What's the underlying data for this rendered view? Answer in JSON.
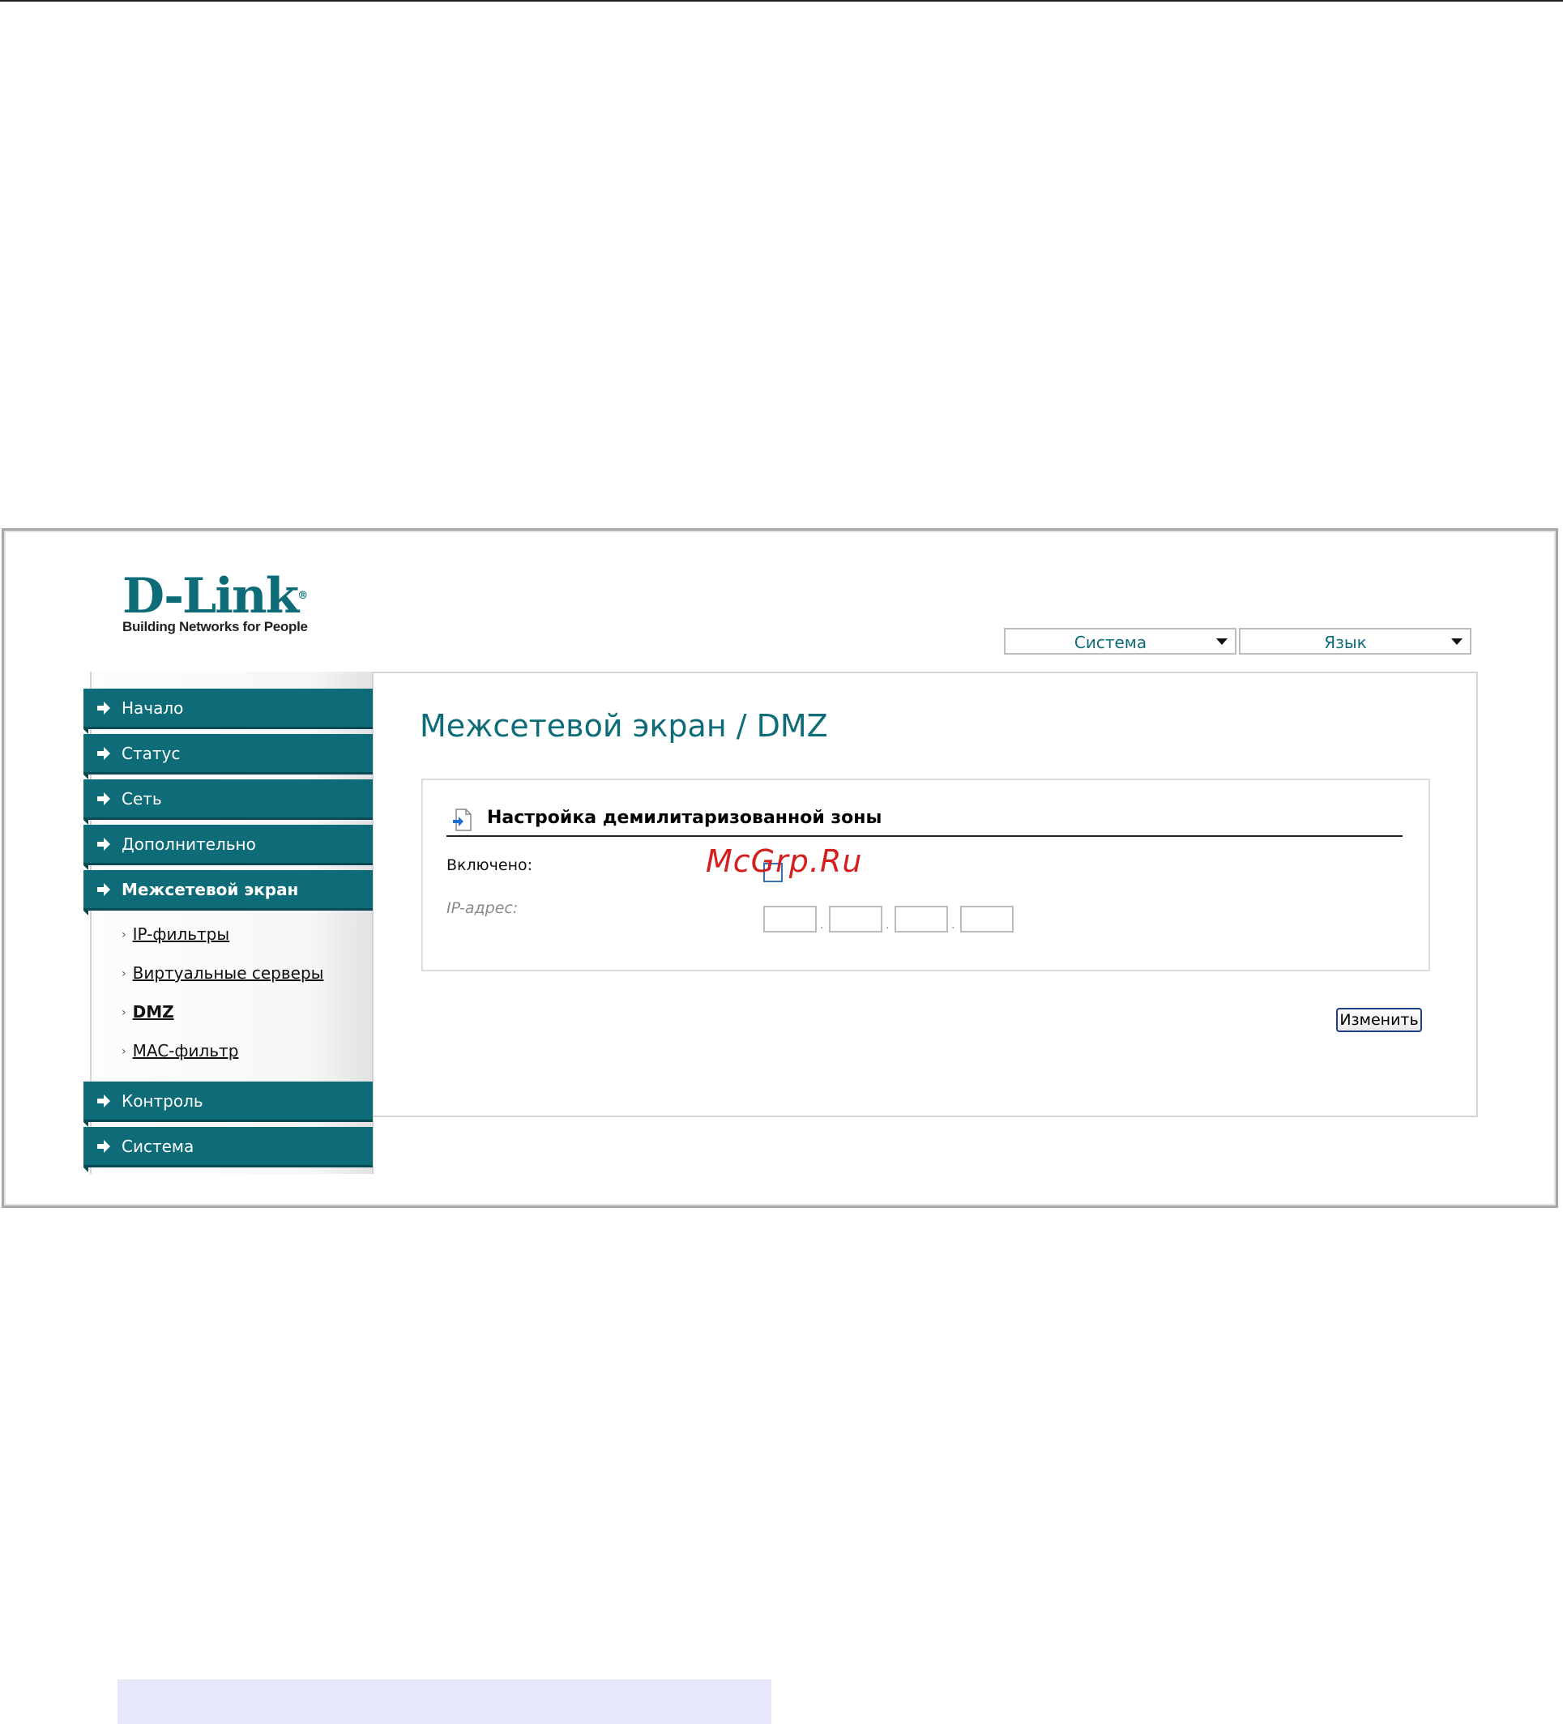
{
  "brand": {
    "logo_text": "D-Link",
    "tagline": "Building Networks for People"
  },
  "top_menu": {
    "system": "Система",
    "language": "Язык"
  },
  "sidebar": {
    "items": [
      {
        "label": "Начало"
      },
      {
        "label": "Статус"
      },
      {
        "label": "Сеть"
      },
      {
        "label": "Дополнительно"
      },
      {
        "label": "Межсетевой экран"
      },
      {
        "label": "Контроль"
      },
      {
        "label": "Система"
      }
    ],
    "subitems": [
      {
        "label": "IP-фильтры"
      },
      {
        "label": "Виртуальные серверы"
      },
      {
        "label": "DMZ"
      },
      {
        "label": "MAC-фильтр"
      }
    ]
  },
  "page": {
    "title": "Межсетевой экран / DMZ",
    "section_title": "Настройка демилитаризованной зоны",
    "enabled_label": "Включено:",
    "ip_label": "IP-адрес:",
    "ip_values": [
      "",
      "",
      "",
      ""
    ],
    "change_button": "Изменить"
  },
  "watermark": "McGrp.Ru",
  "colors": {
    "accent": "#0e6c78",
    "watermark": "#d41f1f"
  }
}
